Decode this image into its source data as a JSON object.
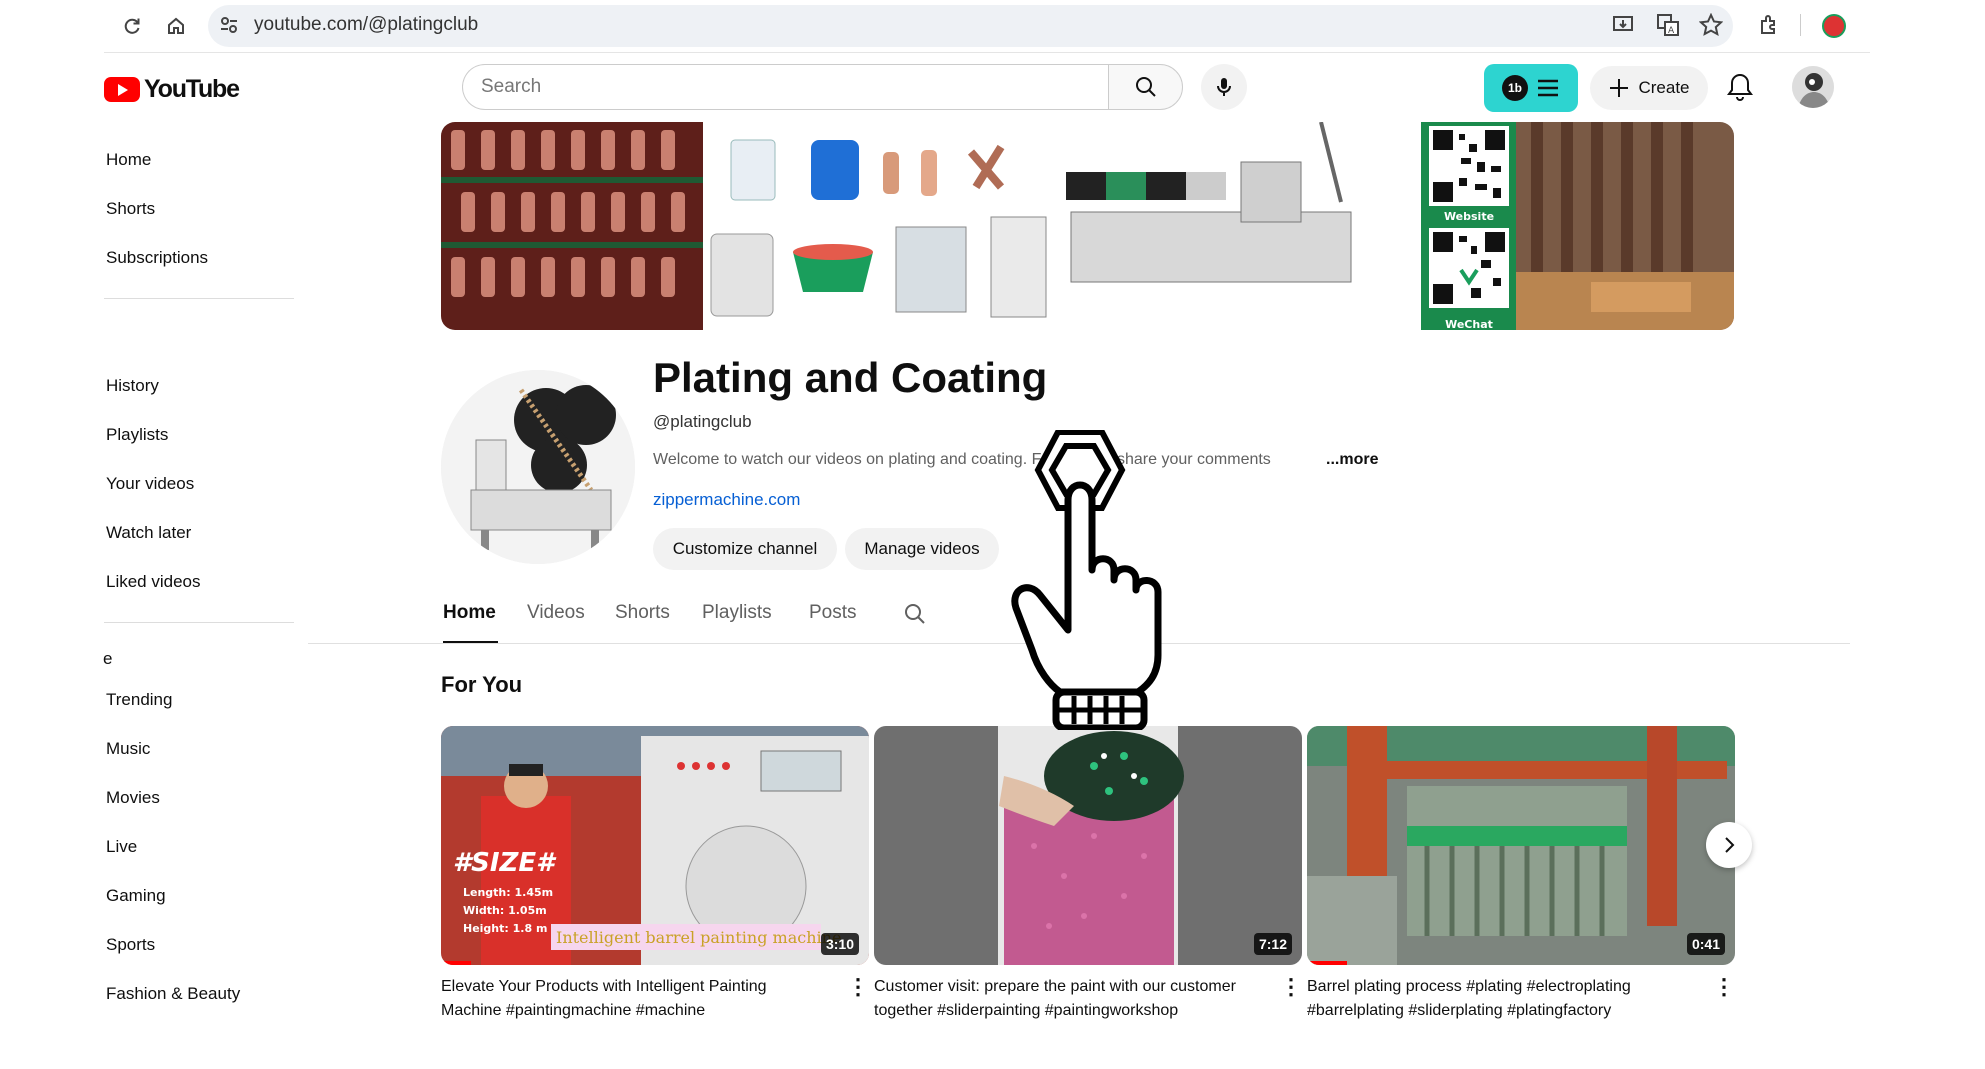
{
  "browser": {
    "url": "youtube.com/@platingclub"
  },
  "header": {
    "logo_text": "YouTube",
    "search_placeholder": "Search",
    "create_label": "Create"
  },
  "sidebar": {
    "items_top": [
      "Home",
      "Shorts",
      "Subscriptions"
    ],
    "items_you": [
      "History",
      "Playlists",
      "Your videos",
      "Watch later",
      "Liked videos"
    ],
    "section_label": "e",
    "items_explore": [
      "Trending",
      "Music",
      "Movies",
      "Live",
      "Gaming",
      "Sports",
      "Fashion & Beauty"
    ]
  },
  "banner": {
    "qr_label_1": "Website",
    "qr_label_2": "WeChat"
  },
  "channel": {
    "title": "Plating and Coating",
    "handle": "@platingclub",
    "description": "Welcome to watch our videos on plating and coating. Feel free to share your comments",
    "more": "...more",
    "link": "zippermachine.com",
    "customize_label": "Customize channel",
    "manage_label": "Manage videos"
  },
  "tabs": [
    "Home",
    "Videos",
    "Shorts",
    "Playlists",
    "Posts"
  ],
  "section_title": "For You",
  "videos": [
    {
      "title": "Elevate Your Products with Intelligent Painting Machine #paintingmachine #machine",
      "duration": "3:10",
      "overlay_big": "#SIZE#",
      "overlay_lines": [
        "Length: 1.45m",
        "Width: 1.05m",
        "Height: 1.8 m"
      ],
      "overlay_caption": "Intelligent barrel painting machine"
    },
    {
      "title": "Customer visit: prepare the paint with our customer together #sliderpainting #paintingworkshop",
      "duration": "7:12"
    },
    {
      "title": "Barrel plating process #plating #electroplating #barrelplating #sliderplating #platingfactory",
      "duration": "0:41"
    }
  ],
  "colors": {
    "brand_red": "#ff0000",
    "link_blue": "#065fd4",
    "extension_teal": "#2dd4d0"
  }
}
